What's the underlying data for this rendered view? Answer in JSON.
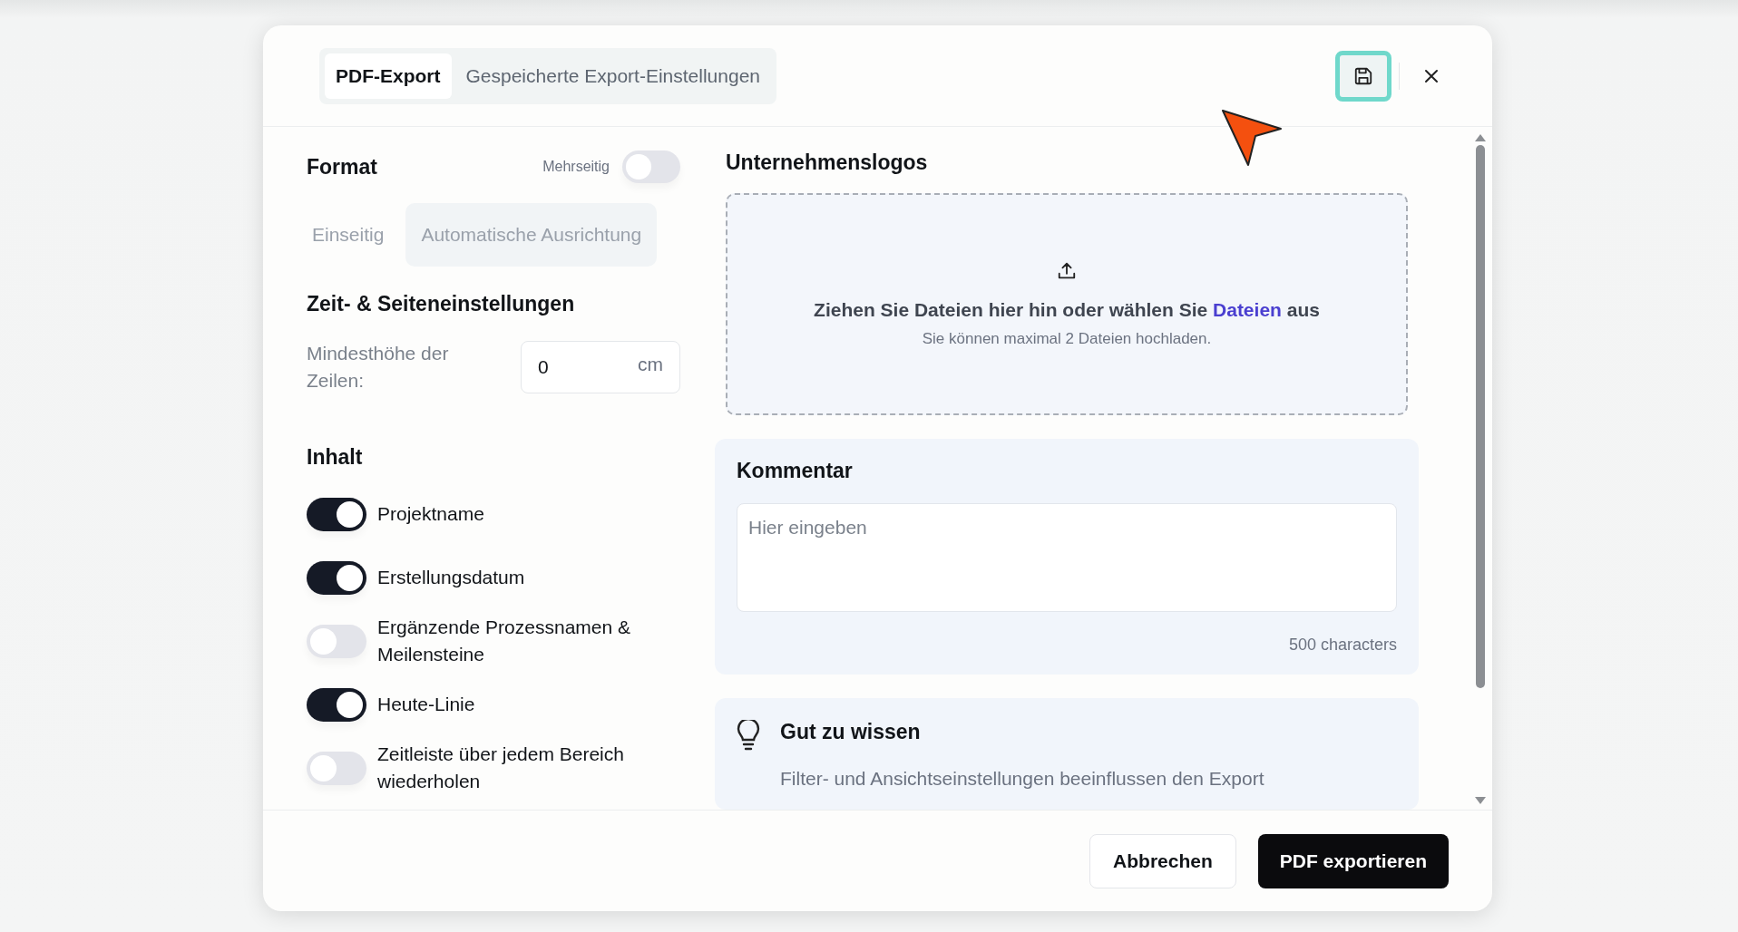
{
  "tabs": [
    {
      "label": "PDF-Export",
      "selected": true
    },
    {
      "label": "Gespeicherte Export-Einstellungen",
      "selected": false
    }
  ],
  "header": {
    "save_highlighted": true
  },
  "format": {
    "title": "Format",
    "multipage": {
      "label": "Mehrseitig",
      "on": false
    },
    "options_disabled": true,
    "options": [
      {
        "label": "Einseitig",
        "selected": false
      },
      {
        "label": "Automatische Ausrichtung",
        "selected": true
      }
    ]
  },
  "time_settings": {
    "title": "Zeit- & Seiteneinstellungen",
    "row_height": {
      "label": "Mindesthöhe der Zeilen:",
      "value": "0",
      "unit": "cm"
    }
  },
  "content": {
    "title": "Inhalt",
    "toggles": [
      {
        "label": "Projektname",
        "on": true
      },
      {
        "label": "Erstellungsdatum",
        "on": true
      },
      {
        "label": "Ergänzende Prozessnamen & Meilensteine",
        "on": false
      },
      {
        "label": "Heute-Linie",
        "on": true
      },
      {
        "label": "Zeitleiste über jedem Bereich wiederholen",
        "on": false
      }
    ]
  },
  "logos": {
    "title": "Unternehmenslogos",
    "drop_text_before": "Ziehen Sie Dateien hier hin oder wählen Sie",
    "drop_link": "Dateien",
    "drop_text_after": "aus",
    "hint": "Sie können maximal 2 Dateien hochladen."
  },
  "comment": {
    "title": "Kommentar",
    "placeholder": "Hier eingeben",
    "counter": "500 characters"
  },
  "info": {
    "title": "Gut zu wissen",
    "text": "Filter- und Ansichtseinstellungen beeinflussen den Export"
  },
  "footer": {
    "buttons": [
      {
        "label": "Abbrechen",
        "kind": "secondary"
      },
      {
        "label": "PDF exportieren",
        "kind": "primary"
      }
    ]
  }
}
